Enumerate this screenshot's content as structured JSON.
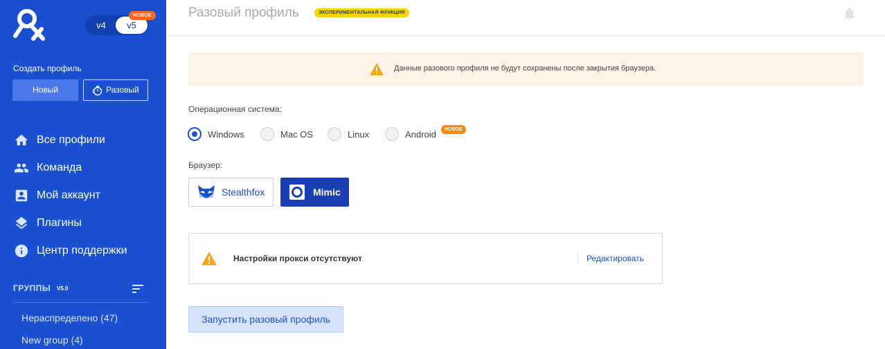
{
  "sidebar": {
    "version": {
      "v4": "v4",
      "v5": "v5",
      "badge": "НОВОЕ"
    },
    "create_label": "Создать профиль",
    "new_button": "Новый",
    "onetime_button": "Разовый",
    "nav": [
      {
        "label": "Все профили",
        "icon": "home-icon"
      },
      {
        "label": "Команда",
        "icon": "team-icon"
      },
      {
        "label": "Мой аккаунт",
        "icon": "account-icon"
      },
      {
        "label": "Плагины",
        "icon": "layers-icon"
      },
      {
        "label": "Центр поддержки",
        "icon": "info-icon"
      }
    ],
    "groups": {
      "title": "ГРУППЫ",
      "version": "V5.0",
      "items": [
        {
          "label": "Нераспределено  (47)"
        },
        {
          "label": "New group  (4)"
        }
      ]
    }
  },
  "header": {
    "title": "Разовый профиль",
    "badge": "ЭКСПЕРИМЕНТАЛЬНАЯ ФУНКЦИЯ"
  },
  "warning": {
    "text": "Данные разового профиля не будут сохранены после закрытия браузера."
  },
  "os": {
    "label": "Операционная система:",
    "options": [
      "Windows",
      "Mac OS",
      "Linux",
      "Android"
    ],
    "selected": "Windows",
    "android_badge": "НОВОЕ"
  },
  "browser": {
    "label": "Браузер:",
    "options": [
      "Stealthfox",
      "Mimic"
    ],
    "selected": "Mimic"
  },
  "proxy": {
    "text": "Настройки прокси отсутствуют",
    "edit": "Редактировать"
  },
  "launch_button": "Запустить разовый профиль",
  "colors": {
    "sidebar": "#1a4fd0",
    "accent": "#1a4fd0",
    "warning": "#f5a623"
  }
}
